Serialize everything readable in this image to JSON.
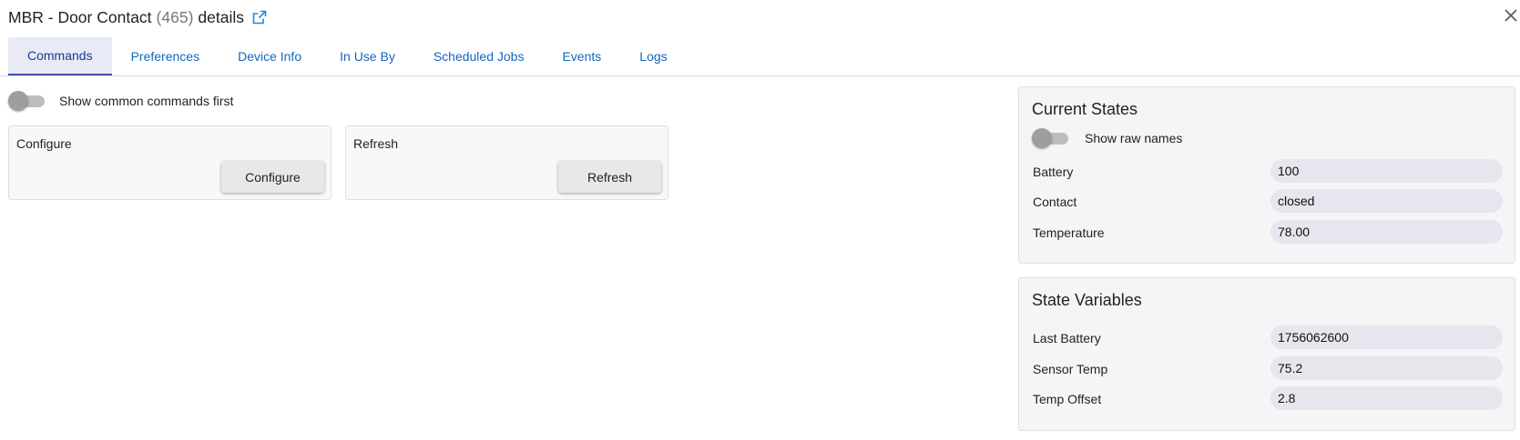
{
  "header": {
    "title": "MBR - Door Contact",
    "count": "(465)",
    "suffix": "details"
  },
  "tabs": [
    {
      "label": "Commands",
      "active": true
    },
    {
      "label": "Preferences"
    },
    {
      "label": "Device Info"
    },
    {
      "label": "In Use By"
    },
    {
      "label": "Scheduled Jobs"
    },
    {
      "label": "Events"
    },
    {
      "label": "Logs"
    }
  ],
  "commands": {
    "toggle_label": "Show common commands first",
    "cards": [
      {
        "title": "Configure",
        "button": "Configure"
      },
      {
        "title": "Refresh",
        "button": "Refresh"
      }
    ]
  },
  "current_states": {
    "title": "Current States",
    "toggle_label": "Show raw names",
    "rows": [
      {
        "label": "Battery",
        "value": "100"
      },
      {
        "label": "Contact",
        "value": "closed"
      },
      {
        "label": "Temperature",
        "value": "78.00"
      }
    ]
  },
  "state_variables": {
    "title": "State Variables",
    "rows": [
      {
        "label": "Last Battery",
        "value": "1756062600"
      },
      {
        "label": "Sensor Temp",
        "value": "75.2"
      },
      {
        "label": "Temp Offset",
        "value": "2.8"
      }
    ]
  },
  "colors": {
    "link": "#1565c0",
    "active_tab_bg": "#e8eaf6",
    "active_tab_indicator": "#3f51b5",
    "panel_bg": "#f5f5f7"
  },
  "icons": {
    "external_link": "external-link-icon",
    "close": "close-icon"
  }
}
